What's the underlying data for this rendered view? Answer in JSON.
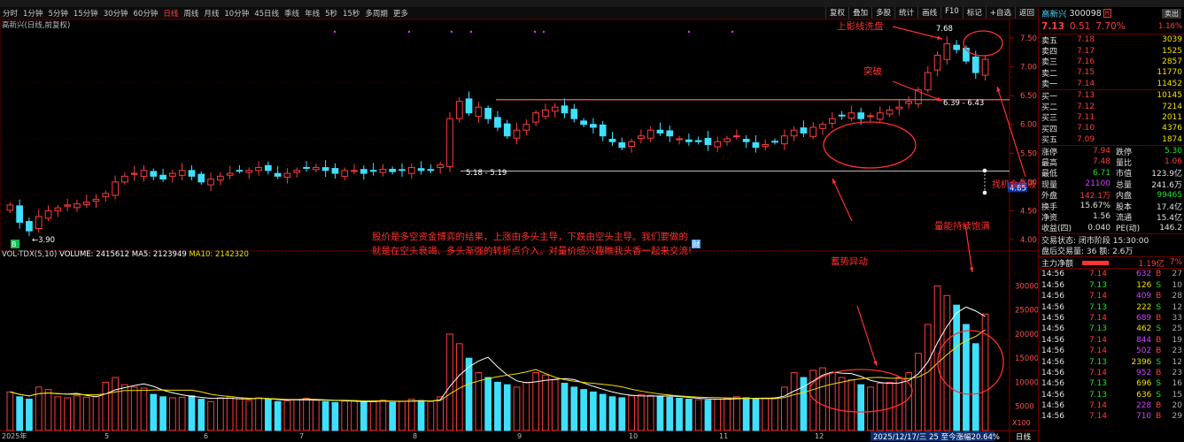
{
  "period_tabs": [
    "分时",
    "1分钟",
    "5分钟",
    "15分钟",
    "30分钟",
    "60分钟",
    "日线",
    "周线",
    "月线",
    "10分钟",
    "45日线",
    "季线",
    "年线",
    "5秒",
    "15秒",
    "多周期",
    "更多"
  ],
  "active_period": "日线",
  "tool_buttons": [
    "复权",
    "叠加",
    "多股",
    "统计",
    "画线",
    "F10",
    "标记",
    "+自选",
    "返回"
  ],
  "main_info": "高新兴(日线,前复权)",
  "vol_info": {
    "label": "VOL-TDX(5,10)",
    "volume": "VOLUME: 2415612",
    "ma5": "MA5: 2123949",
    "ma10": "MA10: 2142320"
  },
  "price_axis": [
    "7.50",
    "7.00",
    "6.50",
    "6.00",
    "5.50",
    "5.00",
    "4.50",
    "4.00"
  ],
  "vol_axis": [
    "30000",
    "25000",
    "20000",
    "15000",
    "10000",
    "5000"
  ],
  "vol_unit": "X100",
  "month_ticks": [
    "2025年",
    "5",
    "6",
    "7",
    "8",
    "9",
    "10",
    "11",
    "12"
  ],
  "date_label": "2025/12/17/三 25 至今涨幅20.64%",
  "date_right": "日线",
  "price_labels": {
    "high": "7.68",
    "low": "3.90",
    "range1": "6.39 - 6.43",
    "range2": "5.18 - 5.19",
    "current": "4.85",
    "b_tag": "B",
    "b_tag2": "财"
  },
  "annotations": {
    "top_shadow": "上影线洗盘",
    "breakout": "突破",
    "low_buy": "找机会低吸",
    "vol_full": "量能持续饱满",
    "accumulate": "蓄势异动",
    "msg1": "股价是多空资金博弈的结果，上涨由多头主导，下跌由空头主导。我们要做的",
    "msg2": "就是在空头衰竭、多头渐强的转折点介入。对量价感兴趣瞧我头香一起来交流!"
  },
  "chart_data": {
    "type": "candlestick",
    "title": "高新兴(日线,前复权)",
    "ylim": [
      3.8,
      7.7
    ],
    "high": 7.68,
    "low": 3.9,
    "levels": [
      6.43,
      5.19
    ],
    "closes": [
      4.6,
      4.3,
      4.15,
      4.4,
      4.5,
      4.55,
      4.6,
      4.62,
      4.65,
      4.7,
      4.8,
      5.0,
      5.1,
      5.15,
      5.2,
      5.1,
      5.05,
      5.15,
      5.2,
      5.1,
      5.0,
      5.05,
      5.1,
      5.15,
      5.2,
      5.2,
      5.25,
      5.2,
      5.1,
      5.15,
      5.2,
      5.25,
      5.25,
      5.2,
      5.15,
      5.2,
      5.2,
      5.15,
      5.2,
      5.22,
      5.18,
      5.2,
      5.25,
      5.2,
      5.2,
      5.3,
      6.1,
      6.4,
      6.2,
      6.3,
      6.1,
      5.95,
      5.8,
      5.9,
      6.0,
      6.2,
      6.25,
      6.3,
      6.2,
      6.1,
      6.0,
      5.95,
      5.8,
      5.7,
      5.6,
      5.7,
      5.8,
      5.9,
      5.85,
      5.8,
      5.75,
      5.7,
      5.7,
      5.65,
      5.7,
      5.75,
      5.8,
      5.7,
      5.6,
      5.65,
      5.7,
      5.8,
      5.9,
      5.85,
      5.95,
      6.0,
      6.1,
      6.15,
      6.2,
      6.1,
      6.15,
      6.2,
      6.25,
      6.3,
      6.4,
      6.6,
      6.9,
      7.2,
      7.4,
      7.3,
      7.1,
      6.9,
      7.13
    ],
    "volumes_x100": [
      8000,
      7000,
      6500,
      9000,
      8500,
      7000,
      6800,
      7200,
      6900,
      7100,
      10000,
      11000,
      9500,
      9000,
      8800,
      7500,
      7000,
      6800,
      6900,
      7200,
      6500,
      6000,
      6800,
      7000,
      6600,
      6200,
      6800,
      6500,
      6000,
      6100,
      6400,
      6700,
      6300,
      6000,
      5800,
      6100,
      6200,
      5900,
      6000,
      6300,
      5800,
      6100,
      6500,
      6200,
      6000,
      7000,
      20000,
      18000,
      15000,
      12000,
      11000,
      10000,
      9500,
      9000,
      10000,
      12000,
      11500,
      10500,
      9800,
      9000,
      8500,
      8000,
      7500,
      7000,
      6800,
      7200,
      7400,
      7300,
      7000,
      6900,
      6700,
      6500,
      6400,
      6300,
      6500,
      6700,
      7000,
      6800,
      6500,
      6600,
      6800,
      9000,
      12000,
      11000,
      12500,
      13000,
      12000,
      11000,
      10500,
      9500,
      9000,
      9800,
      10000,
      11000,
      12000,
      16000,
      22000,
      30000,
      28000,
      26000,
      22000,
      18000,
      24156
    ]
  },
  "right_panel": {
    "code_name": "高新兴",
    "code": "300098",
    "tag": "R",
    "btn_sell": "卖出",
    "price": "7.13",
    "chg": "0.51",
    "pct": "7.70%",
    "rank": "1.16%",
    "asks": [
      {
        "l": "卖五",
        "p": "7.18",
        "v": "3039"
      },
      {
        "l": "卖四",
        "p": "7.17",
        "v": "1525"
      },
      {
        "l": "卖三",
        "p": "7.16",
        "v": "2857"
      },
      {
        "l": "卖二",
        "p": "7.15",
        "v": "11770"
      },
      {
        "l": "卖一",
        "p": "7.14",
        "v": "11452"
      }
    ],
    "bids": [
      {
        "l": "买一",
        "p": "7.13",
        "v": "10145"
      },
      {
        "l": "买二",
        "p": "7.12",
        "v": "7214"
      },
      {
        "l": "买三",
        "p": "7.11",
        "v": "2011"
      },
      {
        "l": "买四",
        "p": "7.10",
        "v": "4376"
      },
      {
        "l": "买五",
        "p": "7.09",
        "v": "1874"
      }
    ],
    "stats": [
      {
        "a": "涨停",
        "b": "7.94",
        "c": "跌停",
        "d": "5.30"
      },
      {
        "a": "最高",
        "b": "7.48",
        "c": "量比",
        "d": "1.06"
      },
      {
        "a": "最低",
        "b": "6.71",
        "c": "市值",
        "d": "123.9亿"
      },
      {
        "a": "现量",
        "b": "21100",
        "c": "总量",
        "d": "241.6万"
      },
      {
        "a": "外盘",
        "b": "142.1万",
        "c": "内盘",
        "d": "99465"
      },
      {
        "a": "换手",
        "b": "15.67%",
        "c": "股本",
        "d": "17.4亿"
      },
      {
        "a": "净资",
        "b": "1.56",
        "c": "流通",
        "d": "15.4亿"
      },
      {
        "a": "收益(四)",
        "b": "0.040",
        "c": "PE(动)",
        "d": "146.2"
      }
    ],
    "trade_state": "交易状态: 闭市阶段 15:30:00",
    "after_hours": "盘后交易量: 36 额: 2.6万",
    "main_flow_label": "主力净额",
    "main_flow_val": "1.19亿",
    "main_flow_pct": "7%",
    "ticks": [
      {
        "t": "14:56",
        "p": "7.14",
        "v": "632",
        "s": "B",
        "n": "27"
      },
      {
        "t": "14:56",
        "p": "7.13",
        "v": "126",
        "s": "S",
        "n": "10"
      },
      {
        "t": "14:56",
        "p": "7.14",
        "v": "409",
        "s": "B",
        "n": "28"
      },
      {
        "t": "14:56",
        "p": "7.13",
        "v": "222",
        "s": "S",
        "n": "12"
      },
      {
        "t": "14:56",
        "p": "7.14",
        "v": "689",
        "s": "B",
        "n": "33"
      },
      {
        "t": "14:56",
        "p": "7.13",
        "v": "462",
        "s": "S",
        "n": "25"
      },
      {
        "t": "14:56",
        "p": "7.14",
        "v": "844",
        "s": "B",
        "n": "19"
      },
      {
        "t": "14:56",
        "p": "7.14",
        "v": "502",
        "s": "B",
        "n": "23"
      },
      {
        "t": "14:56",
        "p": "7.13",
        "v": "2396",
        "s": "S",
        "n": "12"
      },
      {
        "t": "14:56",
        "p": "7.14",
        "v": "952",
        "s": "B",
        "n": "23"
      },
      {
        "t": "14:56",
        "p": "7.13",
        "v": "696",
        "s": "S",
        "n": "16"
      },
      {
        "t": "14:56",
        "p": "7.13",
        "v": "636",
        "s": "S",
        "n": "15"
      },
      {
        "t": "14:56",
        "p": "7.14",
        "v": "228",
        "s": "B",
        "n": "20"
      },
      {
        "t": "14:56",
        "p": "7.14",
        "v": "710",
        "s": "B",
        "n": "29"
      }
    ]
  }
}
